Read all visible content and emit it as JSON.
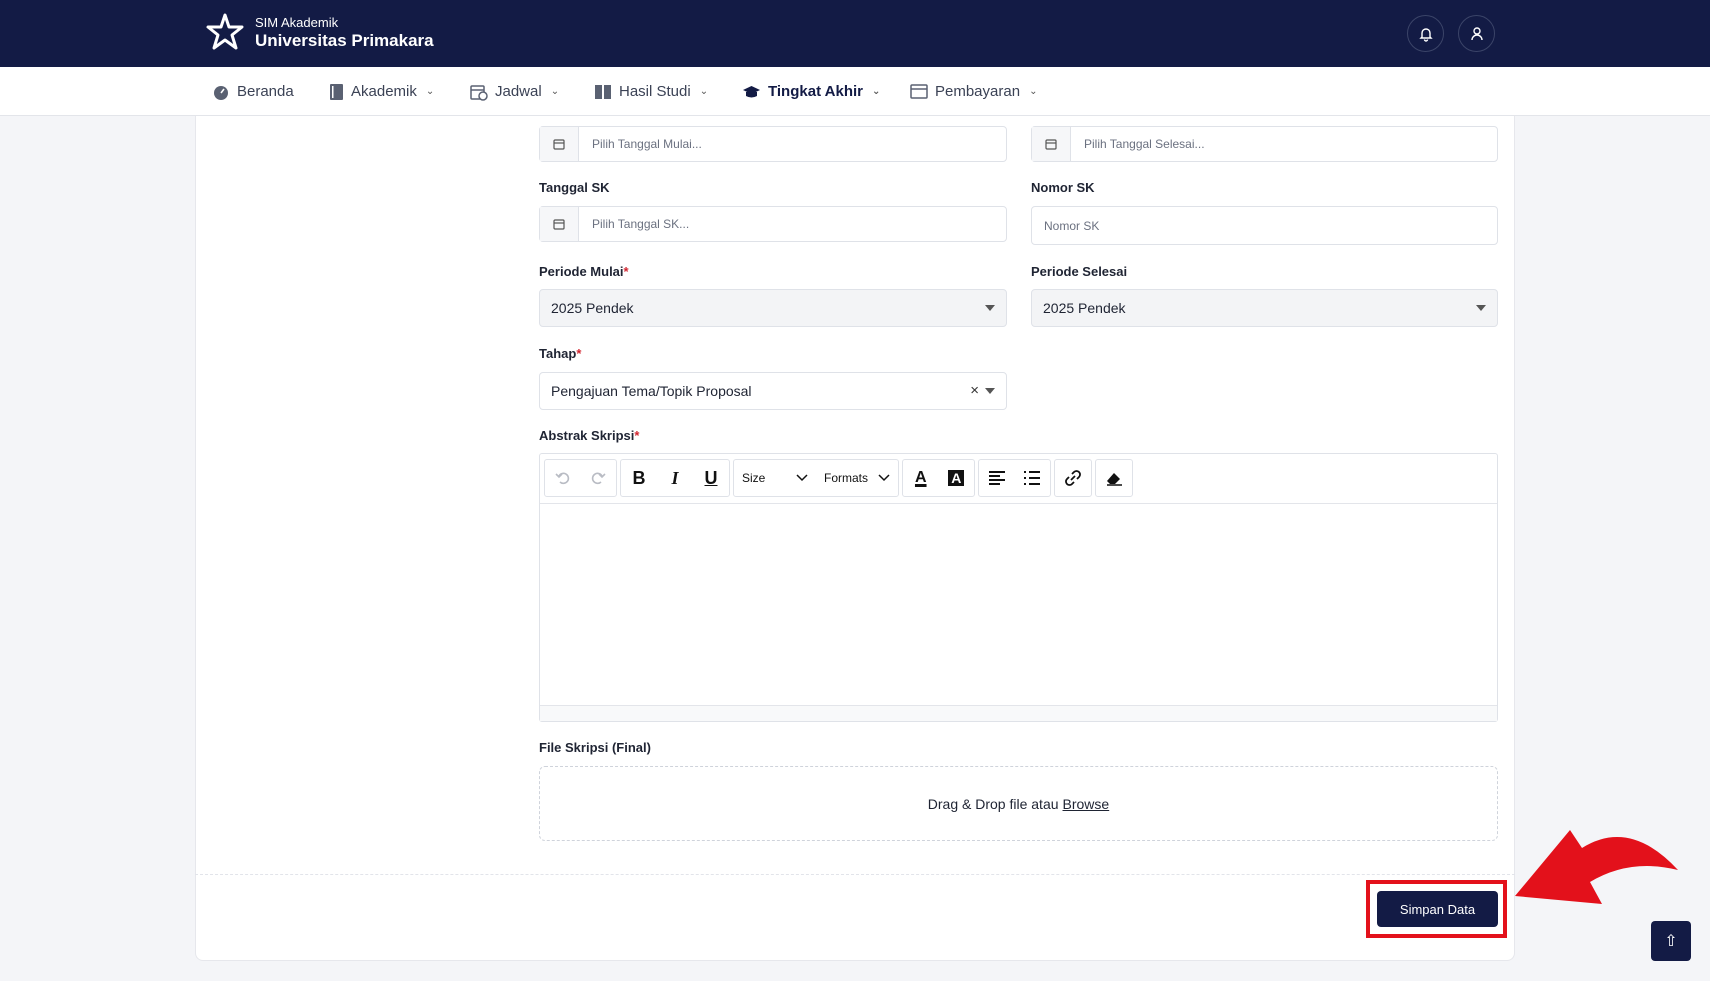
{
  "brand": {
    "subtitle": "SIM Akademik",
    "title": "Universitas Primakara"
  },
  "header": {
    "notification_icon": "bell-icon",
    "profile_icon": "user-icon"
  },
  "nav": {
    "items": [
      {
        "label": "Beranda",
        "icon": "dashboard-icon",
        "dropdown": false
      },
      {
        "label": "Akademik",
        "icon": "book-icon",
        "dropdown": true
      },
      {
        "label": "Jadwal",
        "icon": "calendar-clock-icon",
        "dropdown": true
      },
      {
        "label": "Hasil Studi",
        "icon": "open-book-icon",
        "dropdown": true
      },
      {
        "label": "Tingkat Akhir",
        "icon": "graduation-cap-icon",
        "dropdown": true,
        "active": true
      },
      {
        "label": "Pembayaran",
        "icon": "card-icon",
        "dropdown": true
      }
    ]
  },
  "form": {
    "tanggal_mulai_placeholder": "Pilih Tanggal Mulai...",
    "tanggal_selesai_placeholder": "Pilih Tanggal Selesai...",
    "tanggal_sk_label": "Tanggal SK",
    "tanggal_sk_placeholder": "Pilih Tanggal SK...",
    "nomor_sk_label": "Nomor SK",
    "nomor_sk_placeholder": "Nomor SK",
    "periode_mulai_label": "Periode Mulai",
    "periode_mulai_value": "2025 Pendek",
    "periode_selesai_label": "Periode Selesai",
    "periode_selesai_value": "2025 Pendek",
    "tahap_label": "Tahap",
    "tahap_value": "Pengajuan Tema/Topik Proposal",
    "clear_symbol": "×",
    "abstrak_label": "Abstrak Skripsi",
    "required_mark": "*",
    "editor": {
      "bold": "B",
      "italic": "I",
      "underline": "U",
      "size_label": "Size",
      "formats_label": "Formats",
      "font_color": "A",
      "bg_color": "A"
    },
    "file_label": "File Skripsi (Final)",
    "dropzone_text": "Drag & Drop file atau",
    "dropzone_browse": "Browse",
    "save_label": "Simpan Data"
  },
  "colors": {
    "primary": "#131b45",
    "highlight": "#e3111b",
    "required": "#d1242f"
  },
  "scroll_top_symbol": "⇧"
}
